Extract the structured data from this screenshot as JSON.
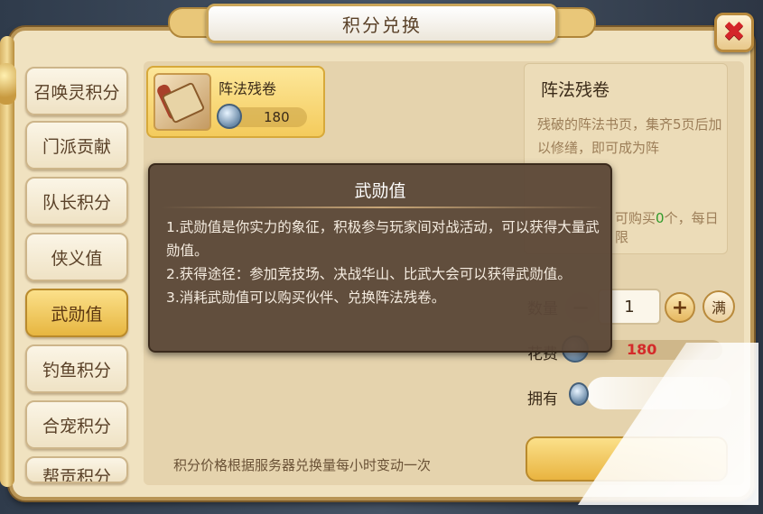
{
  "window": {
    "title": "积分兑换"
  },
  "tabs": [
    {
      "label": "召唤灵积分",
      "active": false
    },
    {
      "label": "门派贡献",
      "active": false
    },
    {
      "label": "队长积分",
      "active": false
    },
    {
      "label": "侠义值",
      "active": false
    },
    {
      "label": "武勋值",
      "active": true
    },
    {
      "label": "钓鱼积分",
      "active": false
    },
    {
      "label": "合宠积分",
      "active": false
    },
    {
      "label": "帮贡积分",
      "active": false
    }
  ],
  "item": {
    "name": "阵法残卷",
    "price": "180",
    "icon": "scroll-icon",
    "currency_icon": "medal-icon"
  },
  "notice": "积分价格根据服务器兑换量每小时变动一次",
  "detail": {
    "title": "阵法残卷",
    "desc": "残破的阵法书页，集齐5页后加以修缮，即可成为阵",
    "limit_prefix": "可购买",
    "limit_count": "0",
    "limit_suffix": "个，每日限"
  },
  "purchase": {
    "qty_label": "数量",
    "qty_value": "1",
    "minus": "−",
    "plus": "+",
    "max": "满",
    "cost_label": "花费",
    "cost_value": "180",
    "own_label": "拥有"
  },
  "tooltip": {
    "title": "武勋值",
    "lines": [
      "1.武勋值是你实力的象征，积极参与玩家间对战活动，可以获得大量武勋值。",
      "2.获得途径：参加竞技场、决战华山、比武大会可以获得武勋值。",
      "3.消耗武勋值可以购买伙伴、兑换阵法残卷。"
    ]
  },
  "colors": {
    "accent": "#e9b440",
    "cost": "#d42a2a",
    "limit_count": "#2f9a2a"
  }
}
